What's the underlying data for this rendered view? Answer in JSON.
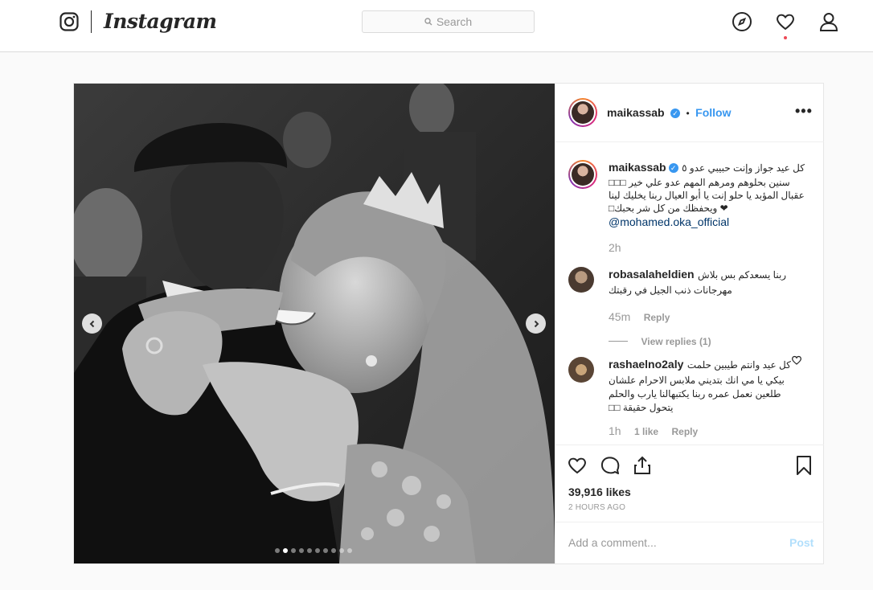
{
  "nav": {
    "brand": "Instagram",
    "search_placeholder": "Search"
  },
  "post": {
    "author": "maikassab",
    "follow_label": "Follow",
    "separator": "•",
    "more_label": "•••",
    "caption": {
      "username": "maikassab",
      "lines": [
        "كل عيد جواز وإنت حبيبي عدو ٥",
        "سنين بحلوهم ومرهم المهم عدو علي خير □□□",
        "عقبال المؤبد يا حلو إنت يا أبو العيال ربنا يخليك لينا",
        "❤ ويحفظك من كل شر بحبك□"
      ],
      "mention": "@mohamed.oka_official",
      "time": "2h"
    },
    "comments": [
      {
        "username": "robasalaheldien",
        "lines": [
          "ربنا يسعدكم بس بلاش",
          "مهرجانات ذنب الجيل في رقبتك"
        ],
        "time": "45m",
        "likes": "",
        "reply_label": "Reply",
        "view_replies": "View replies (1)"
      },
      {
        "username": "rashaelno2aly",
        "lines": [
          "كل عيد وانتم طيبين حلمت",
          "بيكي يا مي انك بتديني ملابس الاحرام علشان",
          "طلعين نعمل عمره ربنا يكتبهالنا يارب والحلم",
          "يتحول حقيقة □□"
        ],
        "time": "1h",
        "likes": "1 like",
        "reply_label": "Reply",
        "view_replies": ""
      }
    ],
    "likes": "39,916 likes",
    "posted_ago": "2 HOURS AGO",
    "add_comment_placeholder": "Add a comment...",
    "post_button": "Post",
    "carousel": {
      "count": 10,
      "active_index": 1
    }
  },
  "colors": {
    "accent": "#3897f0",
    "notification": "#ed4956",
    "border": "#dbdbdb",
    "muted": "#999999"
  },
  "icons": [
    "instagram-logo-icon",
    "search-icon",
    "explore-compass-icon",
    "activity-heart-icon",
    "profile-icon",
    "verified-badge-icon",
    "more-options-icon",
    "like-heart-icon",
    "comment-icon",
    "share-icon",
    "save-bookmark-icon",
    "carousel-prev-icon",
    "carousel-next-icon"
  ]
}
